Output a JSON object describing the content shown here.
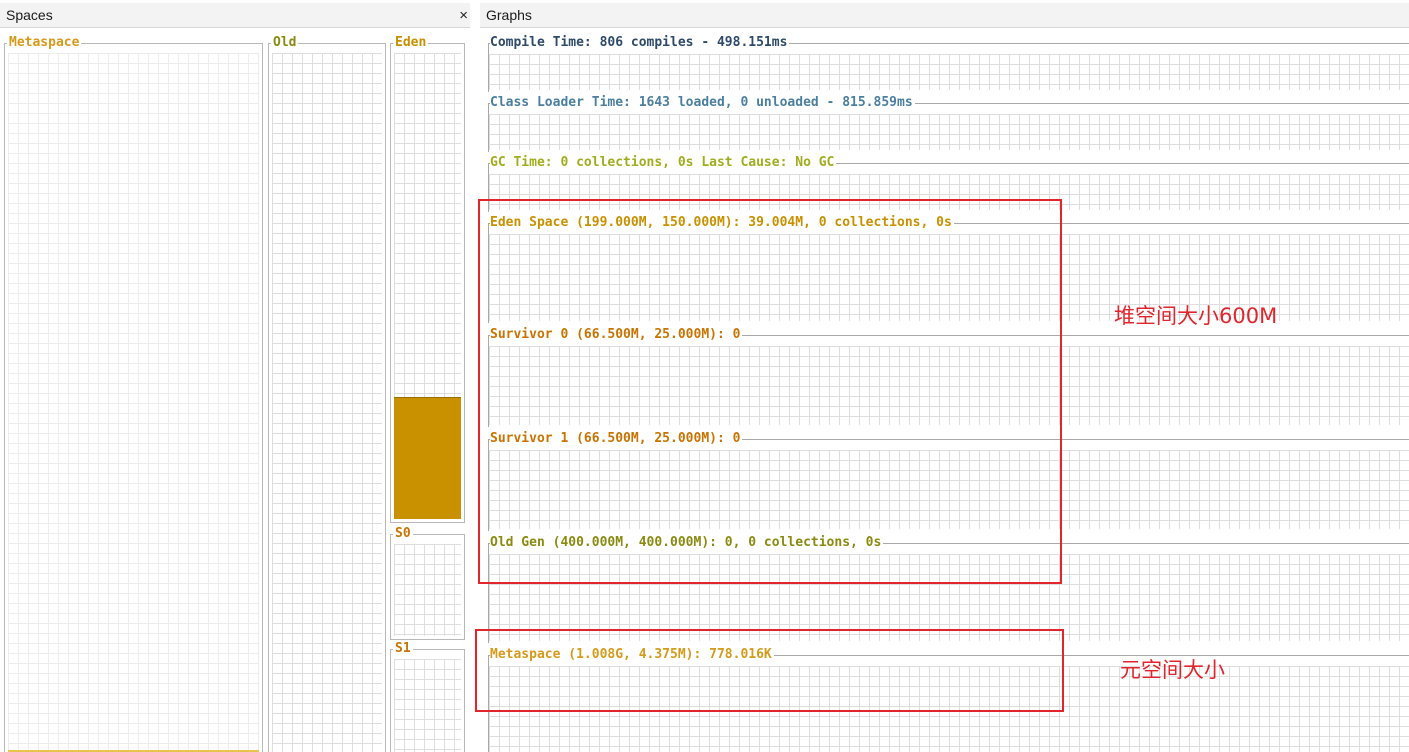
{
  "spaces_panel": {
    "title": "Spaces",
    "close_glyph": "×",
    "metaspace_label": "Metaspace",
    "old_label": "Old",
    "eden_label": "Eden",
    "s0_label": "S0",
    "s1_label": "S1",
    "eden_fill_fraction": 0.26,
    "metaspace_fill_fraction": 0.002
  },
  "graphs_panel": {
    "title": "Graphs",
    "rows": [
      {
        "label": "Compile Time: 806 compiles - 498.151ms",
        "color": "#2d4a6b"
      },
      {
        "label": "Class Loader Time: 1643 loaded, 0 unloaded - 815.859ms",
        "color": "#4a7fa0"
      },
      {
        "label": "GC Time: 0 collections, 0s Last Cause: No GC",
        "color": "#a0ad1c"
      },
      {
        "label": "Eden Space (199.000M, 150.000M): 39.004M, 0 collections, 0s",
        "color": "#c99000"
      },
      {
        "label": "Survivor 0 (66.500M, 25.000M): 0",
        "color": "#c97300"
      },
      {
        "label": "Survivor 1 (66.500M, 25.000M): 0",
        "color": "#c97300"
      },
      {
        "label": "Old Gen (400.000M, 400.000M): 0, 0 collections, 0s",
        "color": "#8a8a10"
      },
      {
        "label": "Metaspace (1.008G, 4.375M): 778.016K",
        "color": "#d49a1a"
      }
    ]
  },
  "annotations": {
    "heap_note": "堆空间大小600M",
    "meta_note": "元空间大小"
  },
  "colors": {
    "annotation_red": "#e0262c",
    "eden_fill": "#c99000"
  }
}
